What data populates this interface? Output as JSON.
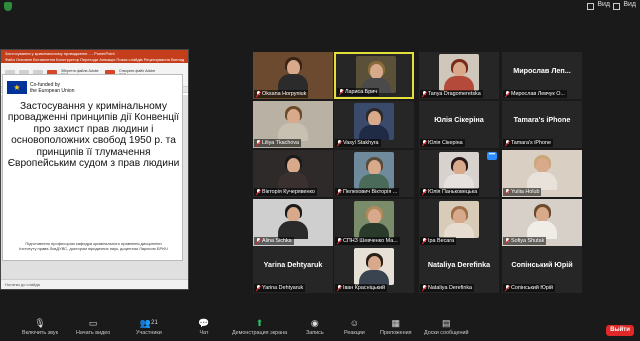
{
  "topbar": {
    "view_label": "Вид",
    "view_label2": "Вид"
  },
  "share": {
    "window_title": "Застосування у кримінальному провадженні... - PowerPoint",
    "ribbon_tabs": "Файл  Основне  Вставлення  Конструктор  Переходи  Анімація  Показ слайдів  Рецензування  Вигляд",
    "ribbon_text1": "Зберегти файли Adobe PDF і надіслати посилання",
    "ribbon_text2": "Створити файл Adobe PDF і надіслати для перегляду",
    "tabs_row": "провадженні, тема 1. Брич    Вкл. Застосування у кримінальному провадженні",
    "eu_text1": "Co-funded by",
    "eu_text2": "the European Union",
    "slide_heading": "Застосування у кримінальному провадженні принципів дії Конвенції про захист прав людини і основоположних свобод 1950 р. та принципів її тлумачення Європейським судом з прав людини",
    "slide_sub": "Підготовлено професором кафедри кримінального правління дисципліни Інституту права ЛьвДУВС, доктором юридичних наук, доцентом Ларисою БРИЧ",
    "status": "Нотатки до слайда"
  },
  "tiles": [
    {
      "name": "Oksana Horpyniuk",
      "kind": "video",
      "bg": "#6b4a2f",
      "hair": "#3a2414",
      "body": "#2b2b2b"
    },
    {
      "name": "Лариса Брич",
      "kind": "video",
      "bg": "#5a5138",
      "hair": "#8a6a3a",
      "body": "#4a4a4a",
      "active": true
    },
    {
      "name": "Tanya Dragomeretska",
      "kind": "video",
      "bg": "#cfc7bc",
      "hair": "#7a2a1a",
      "body": "#b34a3a"
    },
    {
      "name": "Мирослав Левчук О...",
      "kind": "name",
      "big": "Мирослав   Леп..."
    },
    {
      "name": "Liliya Tkachova",
      "kind": "video",
      "bg": "#b9b2a4",
      "hair": "#6b4a2a",
      "body": "#c8c0b0"
    },
    {
      "name": "Vasyl Stakhyra",
      "kind": "video",
      "bg": "#3a4a6a",
      "hair": "#2a2a2a",
      "body": "#1f2b45"
    },
    {
      "name": "Юлія Сікеріна",
      "kind": "name",
      "big": "Юлія Сікеріна"
    },
    {
      "name": "Tamara's iPhone",
      "kind": "name",
      "big": "Tamara's iPhone"
    },
    {
      "name": "Вікторія Кучерявенко",
      "kind": "video",
      "bg": "#2e2a2a",
      "hair": "#1a1a1a",
      "body": "#3a3030"
    },
    {
      "name": "Пелехович Вікторія ...",
      "kind": "video",
      "bg": "#6e8a9c",
      "hair": "#5a4a3a",
      "body": "#4a6a5a"
    },
    {
      "name": "Юлія Паньковецька",
      "kind": "video",
      "bg": "#d8d2cf",
      "hair": "#2a1a1a",
      "body": "#e6e1de",
      "more": true
    },
    {
      "name": "Yuliia Holub",
      "kind": "video",
      "bg": "#d9cfc2",
      "hair": "#c9a878",
      "body": "#e8e2da"
    },
    {
      "name": "Alina Sichka",
      "kind": "video",
      "bg": "#cfcfcf",
      "hair": "#1a1a1a",
      "body": "#2a2a2a"
    },
    {
      "name": "СПНЗ Шевченко Ма...",
      "kind": "video",
      "bg": "#7a8c6a",
      "hair": "#b08a5a",
      "body": "#2a3a2a"
    },
    {
      "name": "Іра Весага",
      "kind": "video",
      "bg": "#d8cbb8",
      "hair": "#a07048",
      "body": "#e6ddd0"
    },
    {
      "name": "Sofiya Shutak",
      "kind": "video",
      "bg": "#d6d0c8",
      "hair": "#6a4a2a",
      "body": "#f0ece6"
    },
    {
      "name": "Yarina Dehtyaruk",
      "kind": "name",
      "big": "Yarina Dehtyaruk"
    },
    {
      "name": "Іван Красніцький",
      "kind": "video",
      "bg": "#e6e0d6",
      "hair": "#2a2018",
      "body": "#3a4450"
    },
    {
      "name": "Nataliya Derefinka",
      "kind": "name",
      "big": "Nataliya Derefinka"
    },
    {
      "name": "Сопінський Юрій",
      "kind": "name",
      "big": "Сопінський Юрій"
    }
  ],
  "toolbar": {
    "mute": "Включить звук",
    "video": "Начать видео",
    "participants": "Участники",
    "participants_count": "21",
    "chat": "Чат",
    "share": "Демонстрация экрана",
    "record": "Запись",
    "reactions": "Реакции",
    "apps": "Приложения",
    "whiteboards": "Доски сообщений",
    "leave": "Выйти"
  },
  "colors": {
    "share_green": "#22c55e",
    "leave_red": "#e02828",
    "active_border": "#e3e03c",
    "ppt_red": "#c43e1c"
  }
}
